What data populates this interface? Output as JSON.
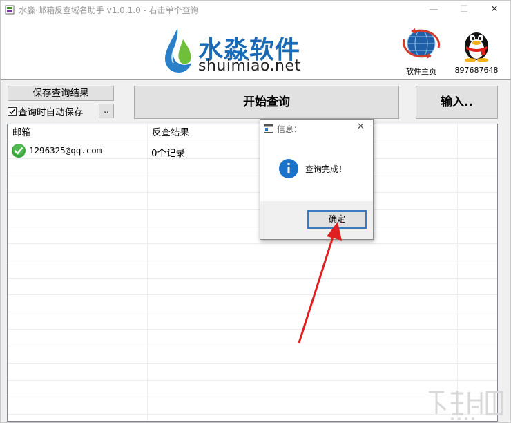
{
  "window": {
    "title": "水淼·邮箱反查域名助手 v1.0.1.0 - 右击单个查询",
    "minimize_glyph": "—",
    "maximize_glyph": "☐",
    "close_glyph": "✕"
  },
  "header": {
    "brand_cn": "水淼软件",
    "brand_en": "shuimiao.net",
    "homepage_label": "软件主页",
    "qq_number": "897687648"
  },
  "toolbar": {
    "save_button": "保存查询结果",
    "auto_save_label": "查询时自动保存",
    "auto_save_checked": true,
    "browse_button": "..",
    "start_button": "开始查询",
    "input_button": "输入.."
  },
  "grid": {
    "columns": [
      "邮箱",
      "反查结果"
    ],
    "rows": [
      {
        "email": "1296325@qq.com",
        "result": "0个记录",
        "status_icon": "green-check-icon"
      }
    ]
  },
  "dialog": {
    "title": "信息：",
    "message": "查询完成！",
    "ok_button": "确定",
    "close_glyph": "✕"
  },
  "colors": {
    "brand_blue": "#1a6ab5",
    "info_blue": "#1a73c9",
    "annotation_red": "#e02020",
    "check_green": "#3aa53a"
  }
}
